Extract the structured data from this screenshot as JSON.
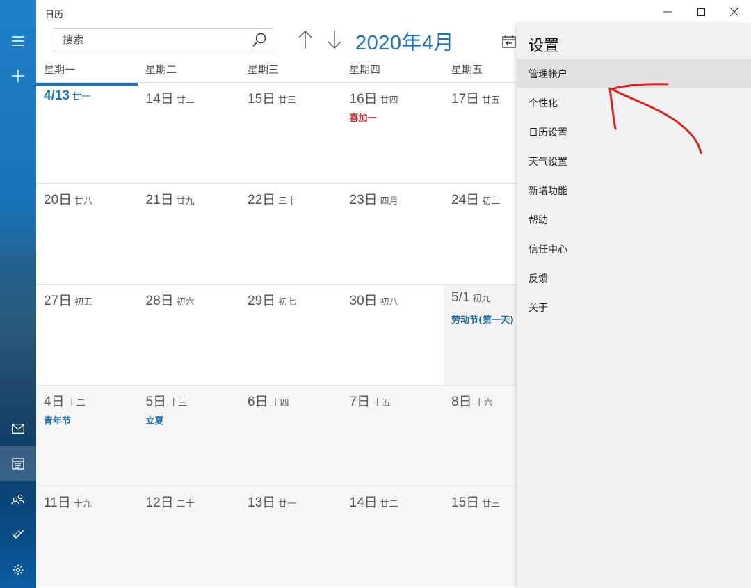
{
  "app": {
    "title": "日历"
  },
  "search": {
    "placeholder": "搜索"
  },
  "header": {
    "month_title": "2020年4月"
  },
  "weekdays": [
    "星期一",
    "星期二",
    "星期三",
    "星期四",
    "星期五"
  ],
  "weeks": [
    [
      {
        "day": "4/13",
        "lunar": "廿一",
        "today": true
      },
      {
        "day": "14日",
        "lunar": "廿二"
      },
      {
        "day": "15日",
        "lunar": "廿三"
      },
      {
        "day": "16日",
        "lunar": "廿四",
        "event": "喜加一",
        "event_color": "#c4262e"
      },
      {
        "day": "17日",
        "lunar": "廿五"
      }
    ],
    [
      {
        "day": "20日",
        "lunar": "廿八"
      },
      {
        "day": "21日",
        "lunar": "廿九"
      },
      {
        "day": "22日",
        "lunar": "三十"
      },
      {
        "day": "23日",
        "lunar": "四月"
      },
      {
        "day": "24日",
        "lunar": "初二"
      }
    ],
    [
      {
        "day": "27日",
        "lunar": "初五"
      },
      {
        "day": "28日",
        "lunar": "初六"
      },
      {
        "day": "29日",
        "lunar": "初七"
      },
      {
        "day": "30日",
        "lunar": "初八"
      },
      {
        "day": "5/1",
        "lunar": "初九",
        "event": "劳动节(第一天)",
        "next_month": true
      }
    ],
    [
      {
        "day": "4日",
        "lunar": "十二",
        "event": "青年节",
        "next_month": true
      },
      {
        "day": "5日",
        "lunar": "十三",
        "event": "立夏",
        "next_month": true
      },
      {
        "day": "6日",
        "lunar": "十四",
        "next_month": true
      },
      {
        "day": "7日",
        "lunar": "十五",
        "next_month": true
      },
      {
        "day": "8日",
        "lunar": "十六",
        "next_month": true
      }
    ],
    [
      {
        "day": "11日",
        "lunar": "十九",
        "next_month": true
      },
      {
        "day": "12日",
        "lunar": "二十",
        "next_month": true
      },
      {
        "day": "13日",
        "lunar": "廿一",
        "next_month": true
      },
      {
        "day": "14日",
        "lunar": "廿二",
        "next_month": true
      },
      {
        "day": "15日",
        "lunar": "廿三",
        "next_month": true
      }
    ]
  ],
  "settings": {
    "title": "设置",
    "items": [
      "管理帐户",
      "个性化",
      "日历设置",
      "天气设置",
      "新增功能",
      "帮助",
      "信任中心",
      "反馈",
      "关于"
    ]
  },
  "colors": {
    "accent": "#1b75bb",
    "event_blue": "#1b6aa8",
    "event_red": "#c4262e",
    "annotation": "#e0201f"
  },
  "icons": {
    "rail": [
      "hamburger-icon",
      "plus-icon",
      "mail-icon",
      "calendar-icon",
      "people-icon",
      "todo-icon",
      "settings-icon"
    ],
    "window": [
      "minimize-icon",
      "maximize-icon",
      "close-icon"
    ]
  }
}
